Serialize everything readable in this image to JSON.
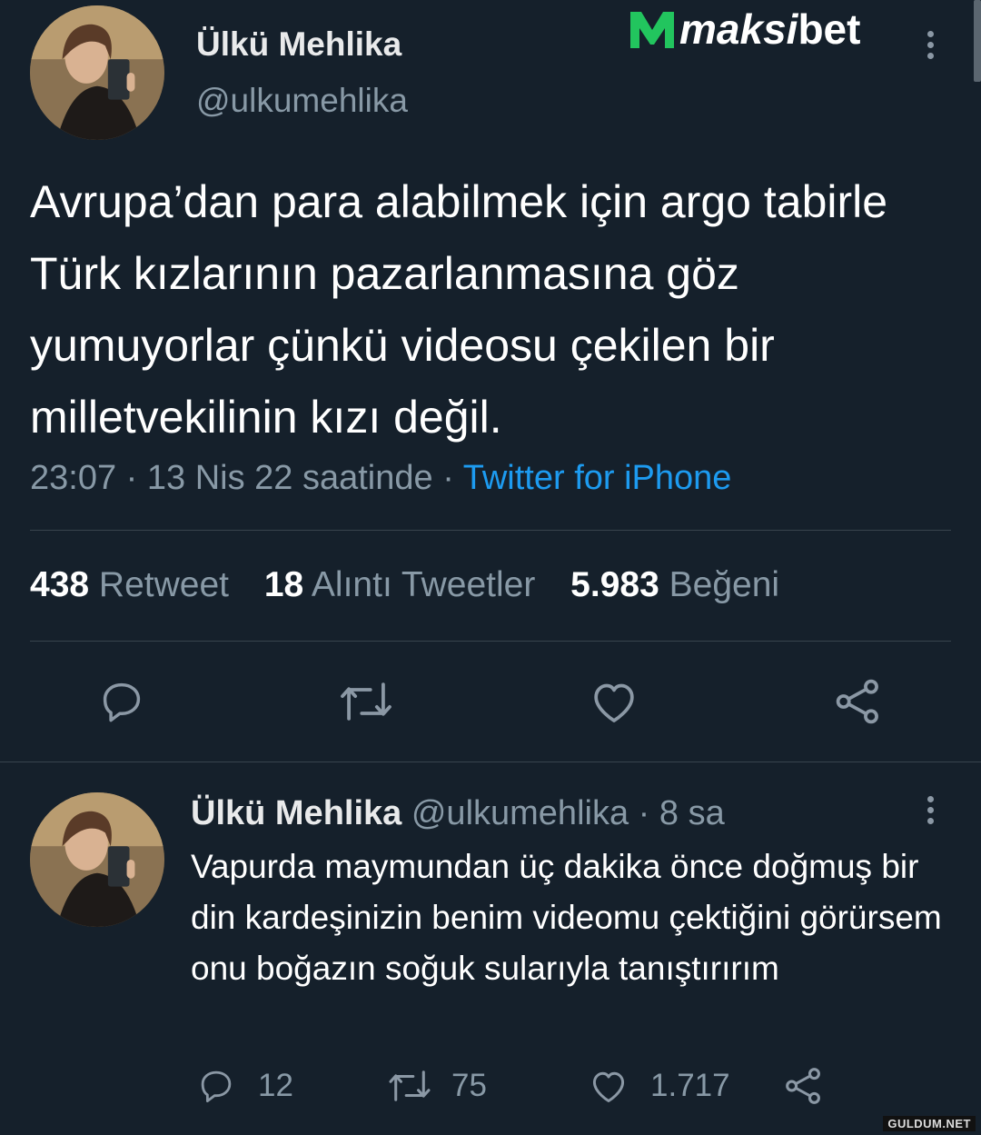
{
  "logo": {
    "brand": "maksibet",
    "mark": "M",
    "text_main": "maksi",
    "text_tail": "bet",
    "mark_color": "#22c55e",
    "text_color": "#ffffff"
  },
  "main_tweet": {
    "author_name": "Ülkü Mehlika",
    "author_handle": "@ulkumehlika",
    "text": "Avrupa’dan para alabilmek için argo tabirle Türk kızlarının pazarlanmasına göz yumuyorlar çünkü videosu çekilen bir milletvekilinin kızı değil.",
    "time": "23:07",
    "date": "13 Nis 22 saatinde",
    "separator": "·",
    "source": "Twitter for iPhone",
    "stats": {
      "retweets_count": "438",
      "retweets_label": "Retweet",
      "quotes_count": "18",
      "quotes_label": "Alıntı Tweetler",
      "likes_count": "5.983",
      "likes_label": "Beğeni"
    },
    "actions": [
      "reply-icon",
      "retweet-icon",
      "like-icon",
      "share-icon"
    ]
  },
  "reply_tweet": {
    "author_name": "Ülkü Mehlika",
    "author_handle": "@ulkumehlika",
    "separator": "·",
    "age": "8 sa",
    "text": "Vapurda maymundan üç dakika önce doğmuş bir din kardeşinizin benim videomu çektiğini görürsem onu boğazın soğuk sularıyla tanıştırırım",
    "replies": "12",
    "retweets": "75",
    "likes": "1.717"
  },
  "watermark": "GULDUM.NET",
  "colors": {
    "background": "#15202b",
    "divider": "#38444d",
    "muted": "#8899a6",
    "link": "#1d9bf0"
  }
}
